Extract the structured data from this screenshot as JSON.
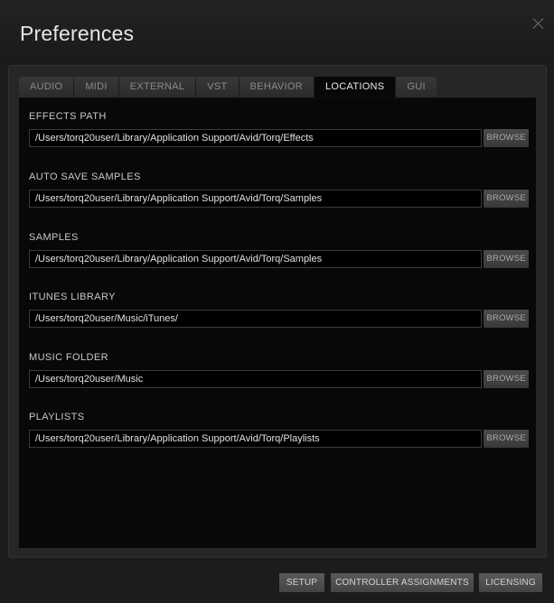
{
  "window": {
    "title": "Preferences",
    "close_icon": "close-icon"
  },
  "tabs": [
    {
      "label": "AUDIO",
      "active": false
    },
    {
      "label": "MIDI",
      "active": false
    },
    {
      "label": "EXTERNAL",
      "active": false
    },
    {
      "label": "VST",
      "active": false
    },
    {
      "label": "BEHAVIOR",
      "active": false
    },
    {
      "label": "LOCATIONS",
      "active": true
    },
    {
      "label": "GUI",
      "active": false
    }
  ],
  "locations": [
    {
      "label": "EFFECTS PATH",
      "path": "/Users/torq20user/Library/Application Support/Avid/Torq/Effects",
      "button": "BROWSE"
    },
    {
      "label": "AUTO SAVE SAMPLES",
      "path": "/Users/torq20user/Library/Application Support/Avid/Torq/Samples",
      "button": "BROWSE"
    },
    {
      "label": "SAMPLES",
      "path": "/Users/torq20user/Library/Application Support/Avid/Torq/Samples",
      "button": "BROWSE"
    },
    {
      "label": "ITUNES LIBRARY",
      "path": "/Users/torq20user/Music/iTunes/",
      "button": "BROWSE"
    },
    {
      "label": "MUSIC FOLDER",
      "path": "/Users/torq20user/Music",
      "button": "BROWSE"
    },
    {
      "label": "PLAYLISTS",
      "path": "/Users/torq20user/Library/Application Support/Avid/Torq/Playlists",
      "button": "BROWSE"
    }
  ],
  "footer": {
    "setup": "SETUP",
    "controller_assignments": "CONTROLLER ASSIGNMENTS",
    "licensing": "LICENSING"
  },
  "colors": {
    "background": "#1c1c1c",
    "panel": "#080808",
    "active_tab_text": "#e8e8e8",
    "inactive_tab_text": "#8a8a8a"
  }
}
